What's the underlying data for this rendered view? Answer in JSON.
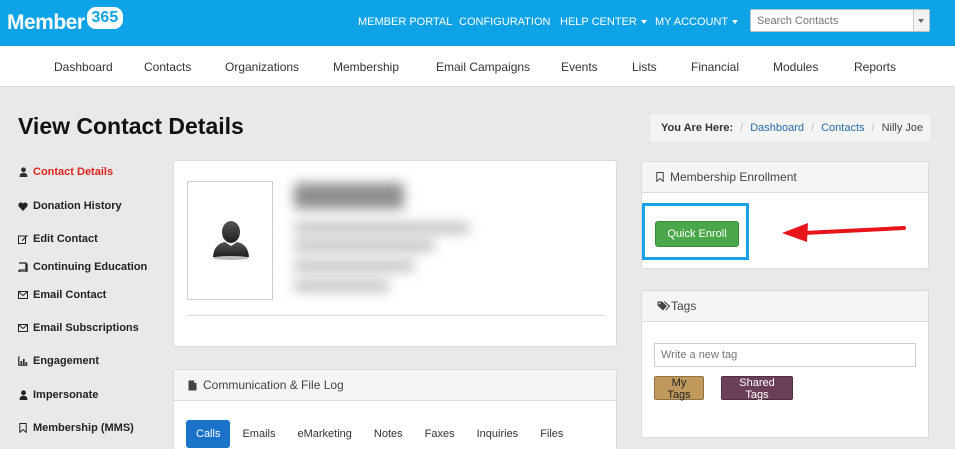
{
  "brand": {
    "logo_text": "Member",
    "logo_num": "365"
  },
  "topnav": {
    "member_portal": "MEMBER PORTAL",
    "configuration": "CONFIGURATION",
    "help_center": "HELP CENTER",
    "my_account": "MY ACCOUNT",
    "search_placeholder": "Search Contacts"
  },
  "subnav": [
    "Dashboard",
    "Contacts",
    "Organizations",
    "Membership",
    "Email Campaigns",
    "Events",
    "Lists",
    "Financial",
    "Modules",
    "Reports"
  ],
  "page": {
    "title": "View Contact Details"
  },
  "breadcrumb": {
    "label": "You Are Here:",
    "items": [
      "Dashboard",
      "Contacts",
      "Nilly Joe"
    ]
  },
  "sidemenu": [
    {
      "label": "Contact Details",
      "icon": "user-icon",
      "active": true
    },
    {
      "label": "Donation History",
      "icon": "heart-icon"
    },
    {
      "label": "Edit Contact",
      "icon": "edit-icon"
    },
    {
      "label": "Continuing Education",
      "icon": "book-icon"
    },
    {
      "label": "Email Contact",
      "icon": "envelope-icon"
    },
    {
      "label": "Email Subscriptions",
      "icon": "envelope-icon"
    },
    {
      "label": "Engagement",
      "icon": "chart-icon"
    },
    {
      "label": "Impersonate",
      "icon": "user-icon"
    },
    {
      "label": "Membership (MMS)",
      "icon": "bookmark-icon"
    }
  ],
  "comm_log": {
    "title": "Communication & File Log",
    "tabs": [
      "Calls",
      "Emails",
      "eMarketing",
      "Notes",
      "Faxes",
      "Inquiries",
      "Files"
    ]
  },
  "membership": {
    "title": "Membership Enrollment",
    "button": "Quick Enroll"
  },
  "tags": {
    "title": "Tags",
    "placeholder": "Write a new tag",
    "my_tags": "My Tags",
    "shared_tags": "Shared Tags"
  },
  "colors": {
    "topbar": "#0ea2e6",
    "active_menu": "#d9251c",
    "enroll_button": "#4aa84a",
    "highlight": "#1aa1e8",
    "arrow": "#e8141b",
    "my_tags": "#c09a5c",
    "shared_tags": "#6b3f58"
  }
}
